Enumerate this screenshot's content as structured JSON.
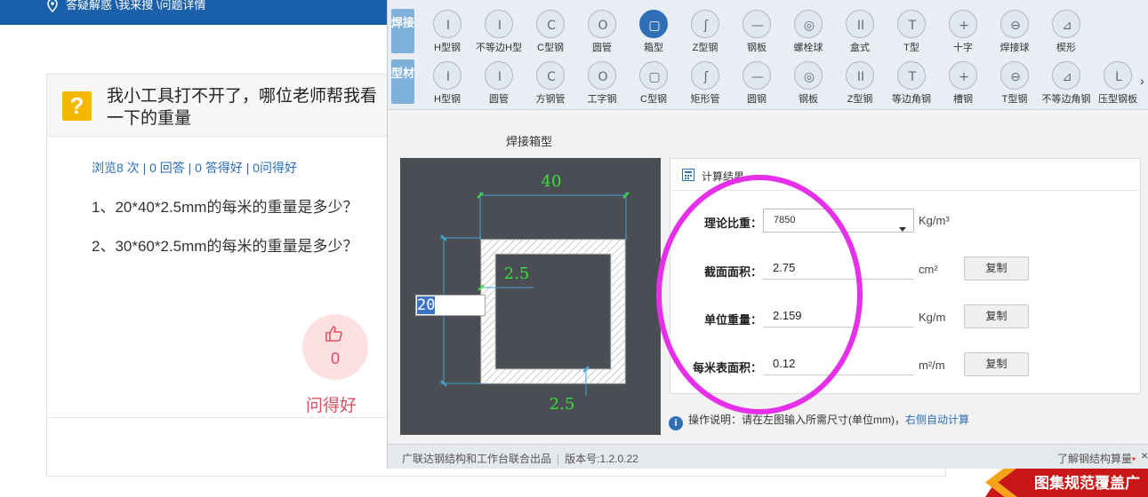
{
  "page": {
    "breadcrumb": "答疑解惑 \\我来搜 \\问题详情",
    "question_title": "我小工具打不开了，哪位老师帮我看一下的重量",
    "stats": "浏览8 次 | 0 回答 | 0 答得好 | 0问得好",
    "lines": [
      "1、20*40*2.5mm的每米的重量是多少？",
      "2、30*60*2.5mm的每米的重量是多少？"
    ],
    "like_count": "0",
    "like_label": "问得好",
    "ad_text": "图集规范覆盖广"
  },
  "tool": {
    "welding_tag": "焊接",
    "profile_tag": "型材",
    "welding_items": [
      "H型钢",
      "不等边H型",
      "C型钢",
      "圆管",
      "箱型",
      "Z型钢",
      "钢板",
      "螺栓球",
      "盒式",
      "T型",
      "十字",
      "焊接球",
      "楔形"
    ],
    "profile_items": [
      "H型钢",
      "圆管",
      "方钢管",
      "工字钢",
      "C型钢",
      "矩形管",
      "圆钢",
      "钢板",
      "Z型钢",
      "等边角钢",
      "槽钢",
      "T型钢",
      "不等边角钢",
      "压型钢板"
    ],
    "active_item": "箱型",
    "section_title": "焊接箱型",
    "drawing": {
      "width_dim": "40",
      "thickness_top": "2.5",
      "thickness_bottom": "2.5",
      "height_input": "20"
    },
    "result": {
      "title": "计算结果",
      "density_label": "理论比重：",
      "density_value": "7850",
      "density_unit": "Kg/m³",
      "area_label": "截面面积：",
      "area_value": "2.75",
      "area_unit": "cm²",
      "weight_label": "单位重量：",
      "weight_value": "2.159",
      "weight_unit": "Kg/m",
      "surface_label": "每米表面积：",
      "surface_value": "0.12",
      "surface_unit": "m²/m",
      "copy_label": "复制"
    },
    "hint_prefix": "操作说明：请在左图输入所需尺寸(单位mm)，",
    "hint_link": "右侧自动计算",
    "footer_left": "广联达钢结构和工作台联合出品",
    "footer_version": "版本号:1.2.0.22",
    "footer_right": "了解钢结构算量"
  },
  "colors": {
    "accent": "#2e6fb6",
    "highlight": "#e52fe8",
    "drawing_bg": "#4a4d53",
    "dim_green": "#37e03a"
  }
}
